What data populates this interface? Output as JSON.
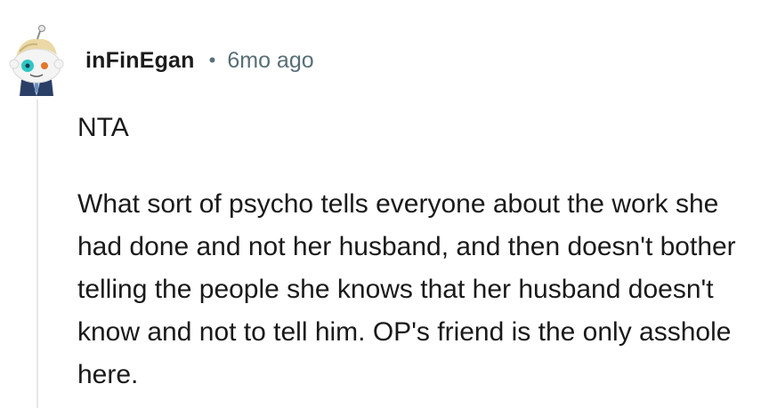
{
  "comment": {
    "author": "inFinEgan",
    "separator": "•",
    "time_ago": "6mo ago",
    "paragraphs": [
      "NTA",
      "What sort of psycho tells everyone about the work she had done and not her husband, and then doesn't bother telling the people she knows that her husband doesn't know and not to tell him. OP's friend is the only asshole here."
    ]
  },
  "icons": {
    "avatar": "snoo-avatar-icon"
  },
  "colors": {
    "username": "#1c1c1c",
    "meta": "#576f76",
    "body_text": "#1a1a1b",
    "thread_line": "#e5e7e9"
  }
}
